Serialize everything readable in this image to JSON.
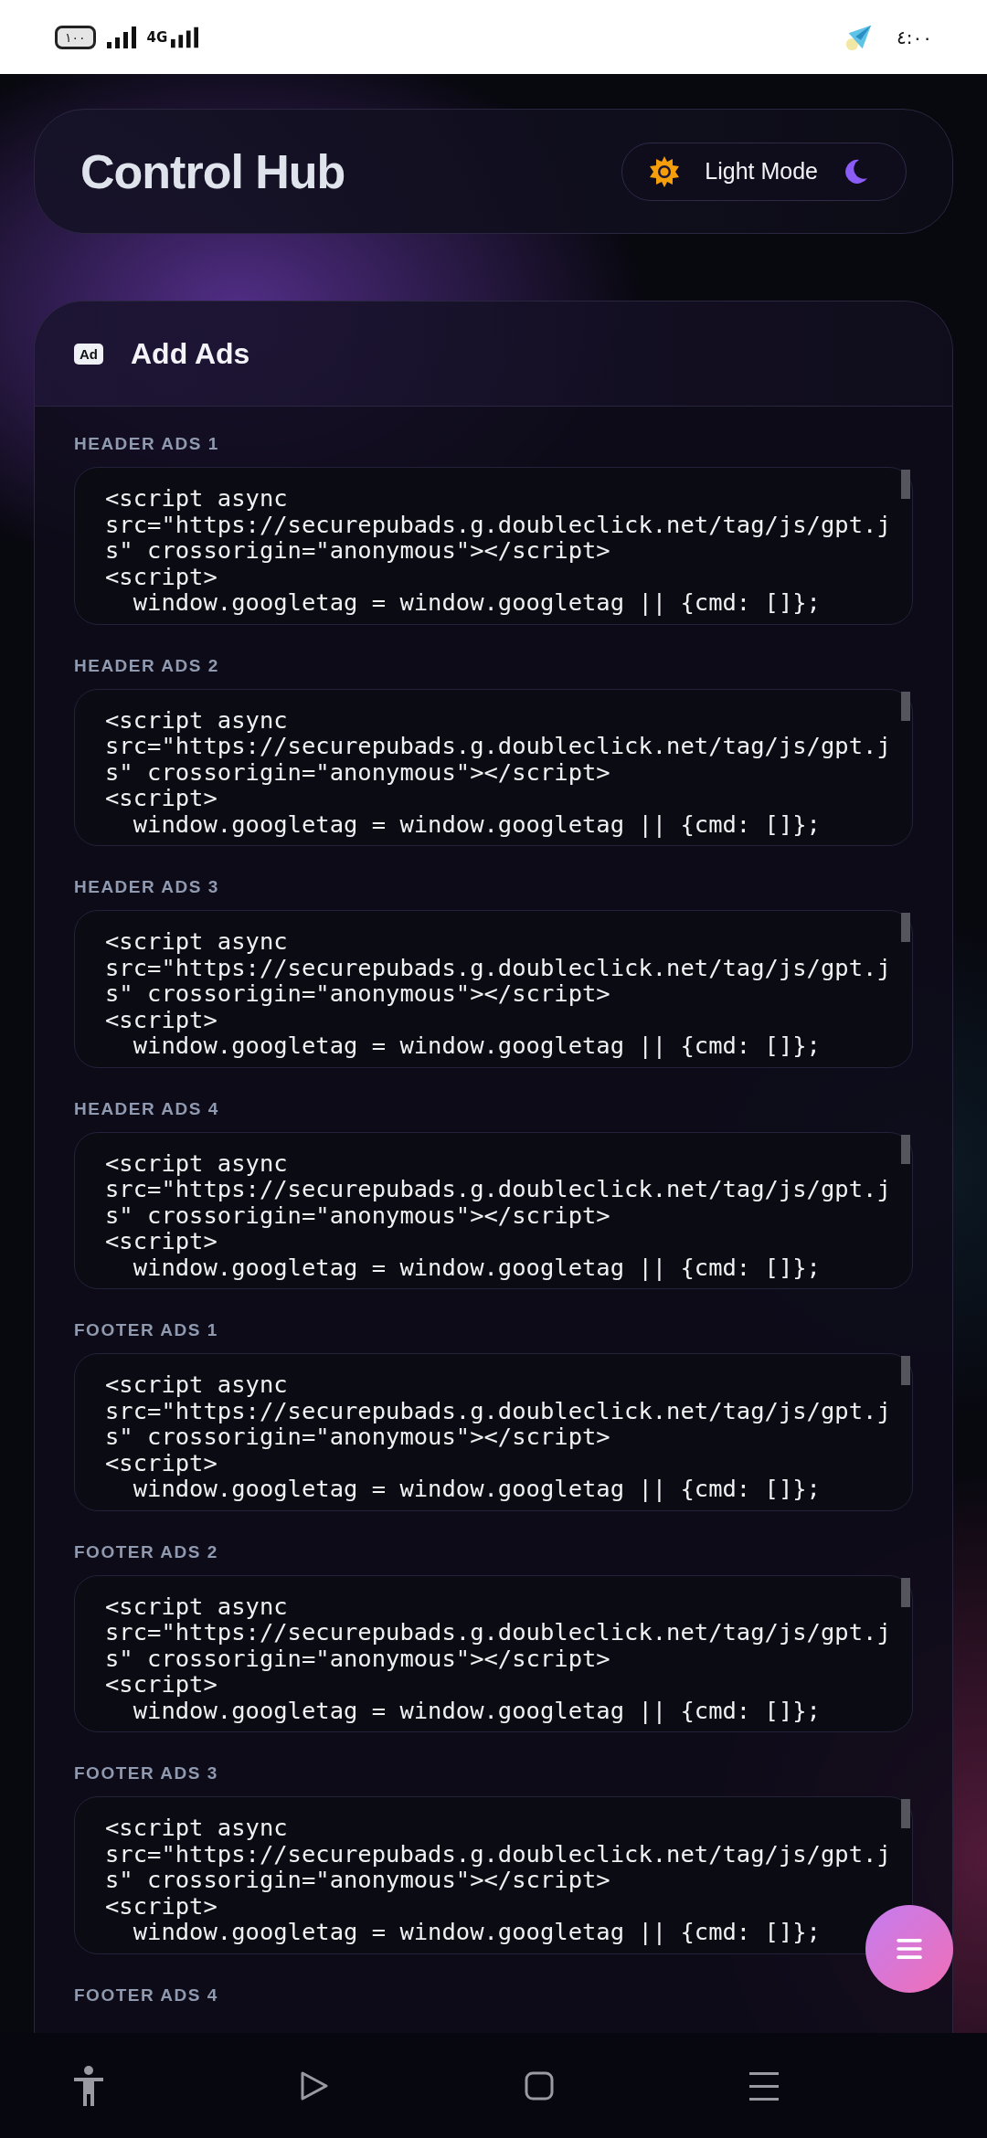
{
  "status_bar": {
    "battery": "١٠٠",
    "network": "4G",
    "time": "٤:٠٠"
  },
  "header": {
    "title": "Control Hub",
    "theme_toggle": {
      "label": "Light Mode"
    }
  },
  "panel": {
    "title": "Add Ads",
    "icon_text": "Ad",
    "fields": [
      {
        "label": "HEADER ADS 1",
        "value": "<script async\nsrc=\"https://securepubads.g.doubleclick.net/tag/js/gpt.j\ns\" crossorigin=\"anonymous\"></script>\n<script>\n  window.googletag = window.googletag || {cmd: []};"
      },
      {
        "label": "HEADER ADS 2",
        "value": "<script async\nsrc=\"https://securepubads.g.doubleclick.net/tag/js/gpt.j\ns\" crossorigin=\"anonymous\"></script>\n<script>\n  window.googletag = window.googletag || {cmd: []};"
      },
      {
        "label": "HEADER ADS 3",
        "value": "<script async\nsrc=\"https://securepubads.g.doubleclick.net/tag/js/gpt.j\ns\" crossorigin=\"anonymous\"></script>\n<script>\n  window.googletag = window.googletag || {cmd: []};"
      },
      {
        "label": "HEADER ADS 4",
        "value": "<script async\nsrc=\"https://securepubads.g.doubleclick.net/tag/js/gpt.j\ns\" crossorigin=\"anonymous\"></script>\n<script>\n  window.googletag = window.googletag || {cmd: []};"
      },
      {
        "label": "FOOTER ADS 1",
        "value": "<script async\nsrc=\"https://securepubads.g.doubleclick.net/tag/js/gpt.j\ns\" crossorigin=\"anonymous\"></script>\n<script>\n  window.googletag = window.googletag || {cmd: []};"
      },
      {
        "label": "FOOTER ADS 2",
        "value": "<script async\nsrc=\"https://securepubads.g.doubleclick.net/tag/js/gpt.j\ns\" crossorigin=\"anonymous\"></script>\n<script>\n  window.googletag = window.googletag || {cmd: []};"
      },
      {
        "label": "FOOTER ADS 3",
        "value": "<script async\nsrc=\"https://securepubads.g.doubleclick.net/tag/js/gpt.j\ns\" crossorigin=\"anonymous\"></script>\n<script>\n  window.googletag = window.googletag || {cmd: []};"
      },
      {
        "label": "FOOTER ADS 4"
      }
    ]
  }
}
